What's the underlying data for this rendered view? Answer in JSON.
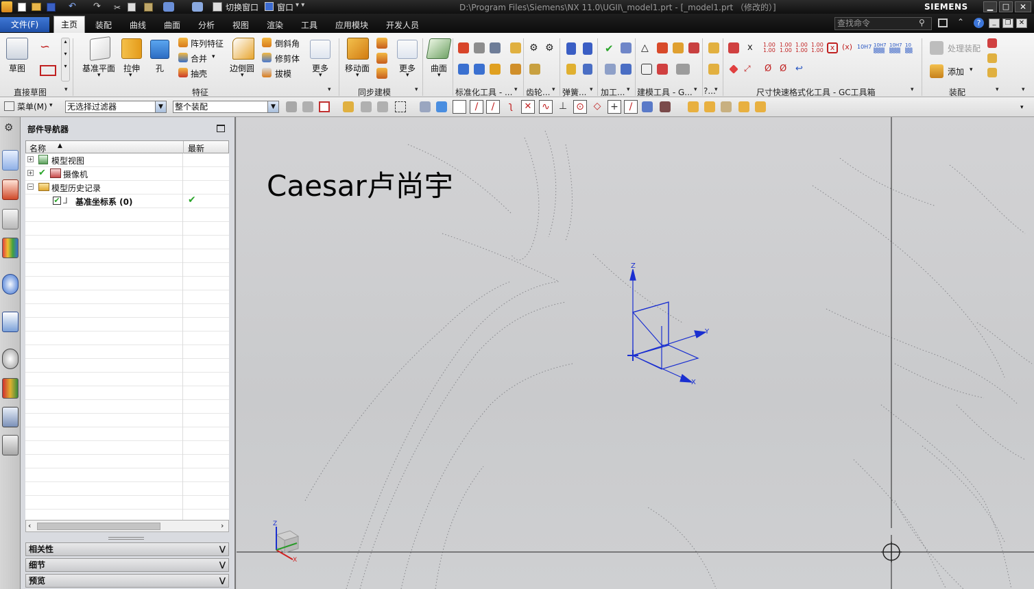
{
  "titlebar": {
    "switch_window": "切换窗口",
    "window_menu": "窗口",
    "path": "D:\\Program Files\\Siemens\\NX 11.0\\UGII\\_model1.prt - [_model1.prt （修改的）]",
    "brand": "SIEMENS"
  },
  "tabs": {
    "file": "文件(F)",
    "items": [
      "主页",
      "装配",
      "曲线",
      "曲面",
      "分析",
      "视图",
      "渲染",
      "工具",
      "应用模块",
      "开发人员"
    ],
    "search_placeholder": "查找命令"
  },
  "ribbon": {
    "sketch": "草图",
    "datum_plane": "基准平面",
    "extrude": "拉伸",
    "hole": "孔",
    "pattern_feature": "阵列特征",
    "unite": "合并",
    "shell": "抽壳",
    "edge_blend": "边倒圆",
    "chamfer": "倒斜角",
    "trim_body": "修剪体",
    "draft": "拔模",
    "more": "更多",
    "move_face": "移动面",
    "more2": "更多",
    "surface": "曲面",
    "add": "添加",
    "process_assembly": "处理装配",
    "groups": {
      "direct_sketch": "直接草图",
      "feature": "特征",
      "sync_modeling": "同步建模",
      "standard_tools": "标准化工具 - ...",
      "gear": "齿轮...",
      "spring": "弹簧...",
      "machining": "加工...",
      "modeling_tools": "建模工具 - G...",
      "short": "?...",
      "dim_format": "尺寸快速格式化工具 - GC工具箱",
      "assembly": "装配"
    }
  },
  "selection_bar": {
    "menu": "菜单(M)",
    "filter": "无选择过滤器",
    "scope": "整个装配"
  },
  "navigator": {
    "title": "部件导航器",
    "col_name": "名称",
    "col_latest": "最新",
    "items": [
      {
        "label": "模型视图"
      },
      {
        "label": "摄像机"
      },
      {
        "label": "模型历史记录"
      },
      {
        "label": "基准坐标系 (0)"
      }
    ],
    "sections": [
      "相关性",
      "细节",
      "预览"
    ]
  },
  "viewport": {
    "watermark": "Caesar卢尚宇",
    "axis_x": "X",
    "axis_y": "Y",
    "axis_z": "Z"
  },
  "colors": {
    "axis_blue": "#1a2fd0",
    "check_green": "#2aa52a"
  }
}
